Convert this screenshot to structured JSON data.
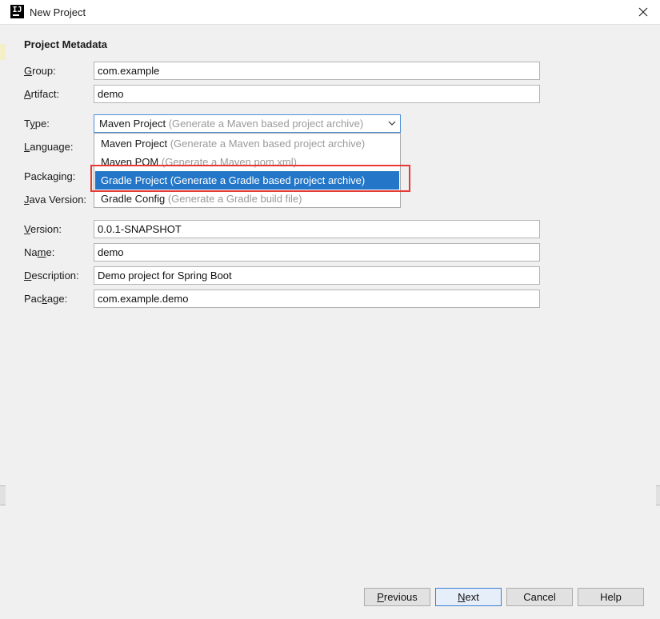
{
  "window": {
    "title": "New Project",
    "app_icon": "intellij-idea-icon"
  },
  "metadata": {
    "section_title": "Project Metadata",
    "group": {
      "label_first": "G",
      "label_rest": "roup:",
      "value": "com.example"
    },
    "artifact": {
      "label_first": "A",
      "label_rest": "rtifact:",
      "value": "demo"
    },
    "type": {
      "label_pre": "T",
      "label_first": "y",
      "label_rest": "pe:",
      "value": "Maven Project",
      "value_hint": "(Generate a Maven based project archive)"
    },
    "language": {
      "label_first": "L",
      "label_rest": "anguage:"
    },
    "packaging": {
      "label_pre": "Packa",
      "label_first": "g",
      "label_rest": "ing:"
    },
    "java_version": {
      "label_first": "J",
      "label_rest": "ava Version:"
    },
    "version": {
      "label_first": "V",
      "label_rest": "ersion:",
      "value": "0.0.1-SNAPSHOT"
    },
    "name": {
      "label_pre": "Na",
      "label_first": "m",
      "label_rest": "e:",
      "value": "demo"
    },
    "description": {
      "label_first": "D",
      "label_rest": "escription:",
      "value": "Demo project for Spring Boot"
    },
    "package": {
      "label_pre": "Pac",
      "label_first": "k",
      "label_rest": "age:",
      "value": "com.example.demo"
    }
  },
  "type_options": [
    {
      "label": "Maven Project",
      "hint": "(Generate a Maven based project archive)"
    },
    {
      "label": "Maven POM",
      "hint": "(Generate a Maven pom.xml)"
    },
    {
      "label": "Gradle Project",
      "hint": "(Generate a Gradle based project archive)"
    },
    {
      "label": "Gradle Config",
      "hint": "(Generate a Gradle build file)"
    }
  ],
  "selected_option_index": 2,
  "buttons": {
    "previous": {
      "first": "P",
      "rest": "revious"
    },
    "next": {
      "first": "N",
      "rest": "ext"
    },
    "cancel": "Cancel",
    "help": "Help"
  },
  "colors": {
    "selection": "#2477c8",
    "highlight_box": "#e53935",
    "focus_border": "#4f8fd6"
  }
}
